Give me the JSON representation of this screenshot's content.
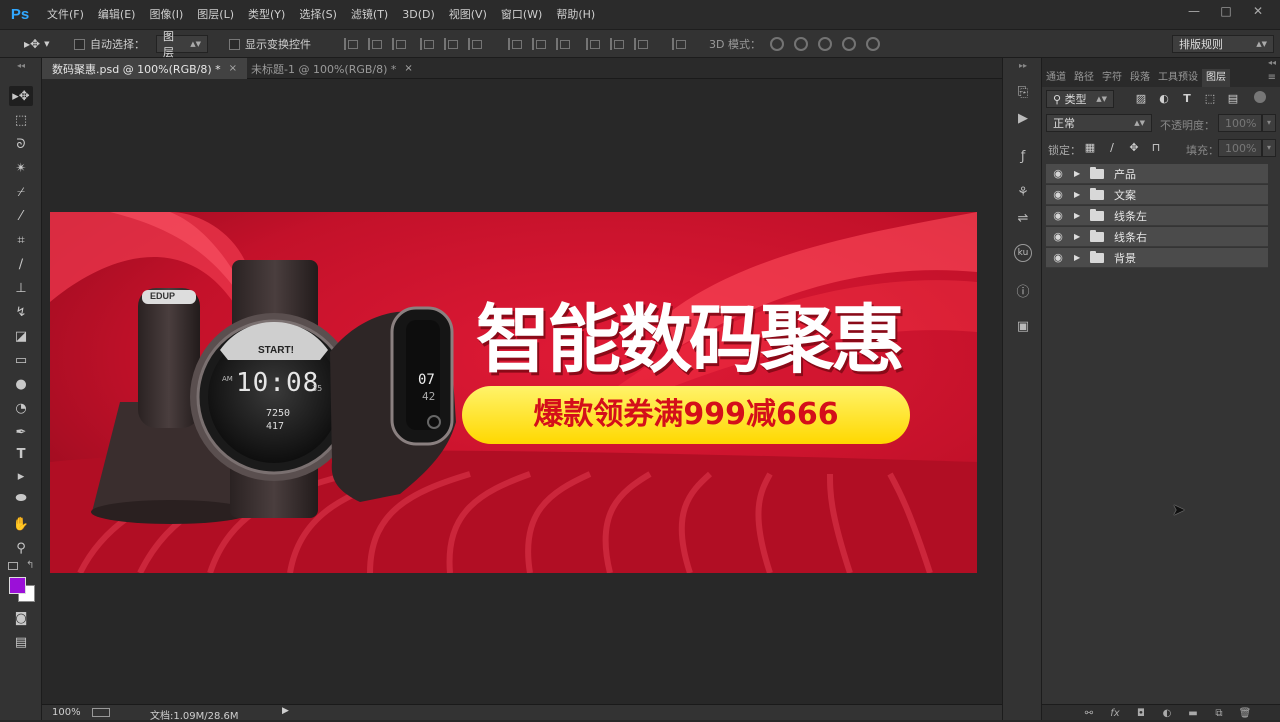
{
  "app": {
    "logo": "Ps",
    "menu": [
      "文件(F)",
      "编辑(E)",
      "图像(I)",
      "图层(L)",
      "类型(Y)",
      "选择(S)",
      "滤镜(T)",
      "3D(D)",
      "视图(V)",
      "窗口(W)",
      "帮助(H)"
    ],
    "window_controls": [
      "—",
      "□",
      "✕"
    ]
  },
  "options": {
    "auto_select_label": "自动选择：",
    "auto_select_value": "图层",
    "show_transform_label": "显示变换控件",
    "mode_3d_label": "3D 模式：",
    "workspace": "排版规则"
  },
  "tabs": [
    {
      "label": "数码聚惠.psd @ 100%(RGB/8) *",
      "active": true
    },
    {
      "label": "未标题-1 @ 100%(RGB/8) *",
      "active": false
    }
  ],
  "banner": {
    "headline": "智能数码聚惠",
    "promo": "爆款领券满999减666",
    "watch_start": "START!",
    "watch_time": "10:08",
    "watch_sec": "35",
    "watch_am": "AM",
    "watch_steps": "7250",
    "watch_cal": "417",
    "band_digit_1": "07",
    "band_digit_2": "42",
    "brand": "EDUP",
    "colors": {
      "bg": "#c4122a",
      "highlight": "#ff3b3b",
      "pill": "#ffe600",
      "pill_text": "#d40f1a"
    }
  },
  "status": {
    "zoom": "100%",
    "doc_info": "文档:1.09M/28.6M"
  },
  "panel": {
    "tabs": [
      "通道",
      "路径",
      "字符",
      "段落",
      "工具预设",
      "图层"
    ],
    "filter_kind": "类型",
    "blend_mode": "正常",
    "opacity_label": "不透明度：",
    "opacity_value": "100%",
    "lock_label": "锁定：",
    "fill_label": "填充：",
    "fill_value": "100%",
    "layers": [
      "产品",
      "文案",
      "线条左",
      "线条右",
      "背景"
    ]
  }
}
